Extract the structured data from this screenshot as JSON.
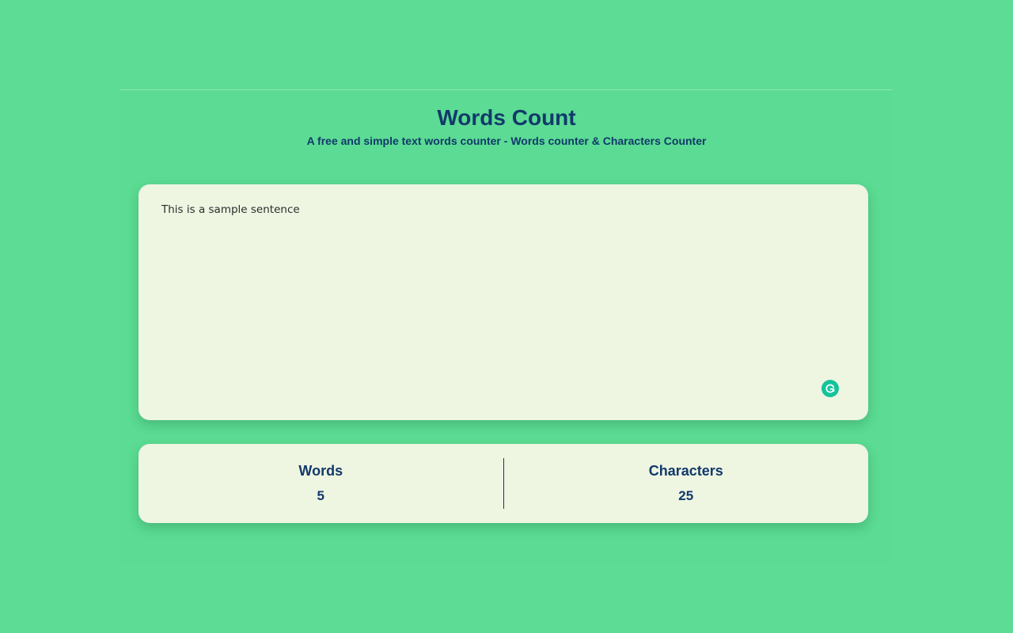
{
  "header": {
    "title": "Words Count",
    "subtitle": "A free and simple text words counter - Words counter & Characters Counter"
  },
  "editor": {
    "text": "This is a sample sentence",
    "grammarly_icon": "grammarly-icon"
  },
  "stats": {
    "words_label": "Words",
    "words_value": "5",
    "characters_label": "Characters",
    "characters_value": "25"
  },
  "colors": {
    "background": "#5cdc94",
    "card": "#eef5e1",
    "text_primary": "#12396b",
    "grammarly": "#15c39a"
  }
}
